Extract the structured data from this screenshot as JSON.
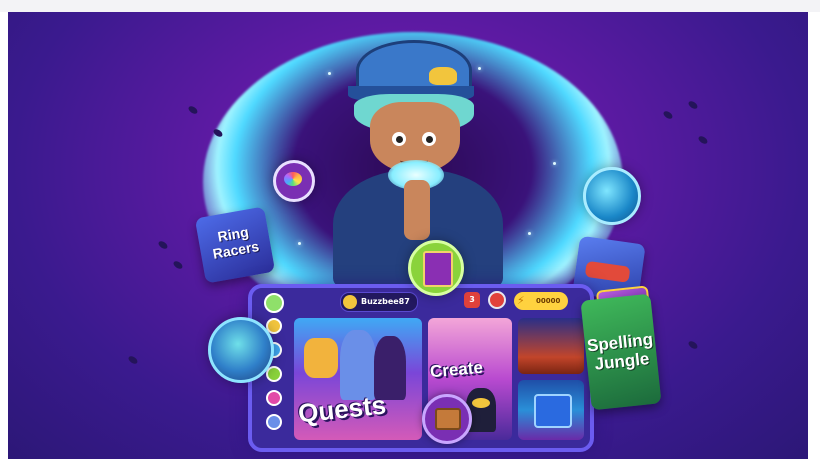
{
  "header": {
    "username": "Buzzbee87",
    "count": "3",
    "coins": "00000"
  },
  "tiles": {
    "quests": "Quests",
    "create": "Create"
  },
  "cubes": {
    "rings": "Ring Racers",
    "jungle": "Spelling Jungle"
  },
  "icons": {
    "avatar": "avatar-icon",
    "user": "user-icon",
    "shield": "shield-icon",
    "bolt": "bolt-icon",
    "globe": "globe-icon",
    "rainbow": "rainbow-icon",
    "book": "book-icon",
    "island": "island-icon",
    "chest": "chest-icon"
  },
  "colors": {
    "background": "#3a1a8e",
    "portal_glow": "#4fd9ff",
    "device": "#3b2a9c",
    "coin": "#ffd23f",
    "accent_red": "#e0413b"
  }
}
